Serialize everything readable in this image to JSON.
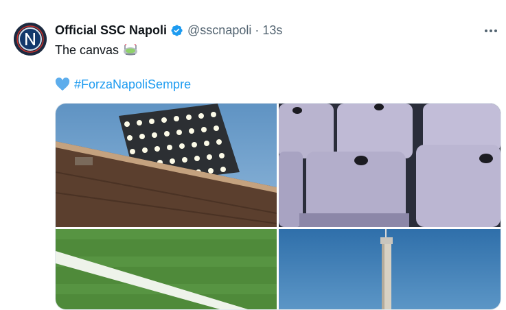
{
  "author": {
    "display_name": "Official SSC Napoli",
    "handle": "@sscnapoli",
    "separator": "·",
    "time": "13s",
    "avatar_icon": "napoli-logo-icon",
    "verified_icon": "verified-badge-icon",
    "verified_color": "#1d9bf0"
  },
  "post": {
    "text": "The canvas",
    "text_emoji": "stadium-emoji-icon",
    "hashtag": "#ForzaNapoliSempre",
    "hashtag_emoji": "blue-heart-icon",
    "hashtag_color": "#1d9bf0"
  },
  "media": {
    "images": [
      {
        "name": "floodlights-photo"
      },
      {
        "name": "stadium-seats-photo"
      },
      {
        "name": "pitch-grass-photo"
      },
      {
        "name": "tower-photo"
      }
    ]
  },
  "menu_icon": "more-options-icon"
}
